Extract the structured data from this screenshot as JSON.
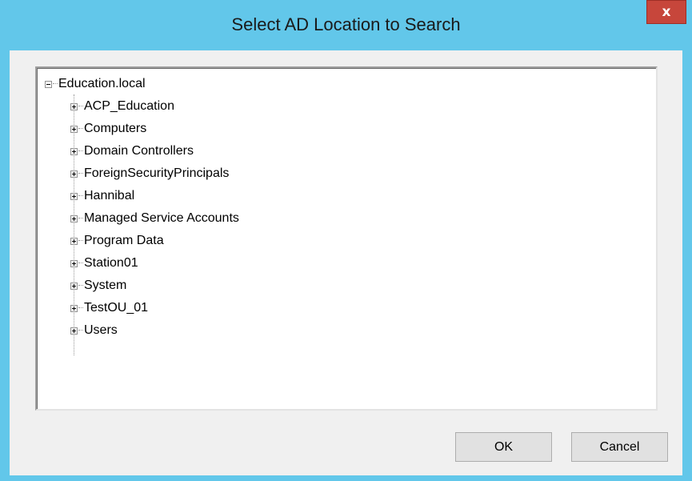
{
  "window": {
    "title": "Select AD Location to Search",
    "close_glyph": "x"
  },
  "tree": {
    "root": {
      "label": "Education.local",
      "expanded": true
    },
    "children": [
      {
        "label": "ACP_Education"
      },
      {
        "label": "Computers"
      },
      {
        "label": "Domain Controllers"
      },
      {
        "label": "ForeignSecurityPrincipals"
      },
      {
        "label": "Hannibal"
      },
      {
        "label": "Managed Service Accounts"
      },
      {
        "label": "Program Data"
      },
      {
        "label": "Station01"
      },
      {
        "label": "System"
      },
      {
        "label": "TestOU_01"
      },
      {
        "label": "Users"
      }
    ]
  },
  "buttons": {
    "ok": "OK",
    "cancel": "Cancel"
  },
  "colors": {
    "titlebar": "#62c7ea",
    "close": "#c7463b",
    "client": "#f0f0f0"
  }
}
